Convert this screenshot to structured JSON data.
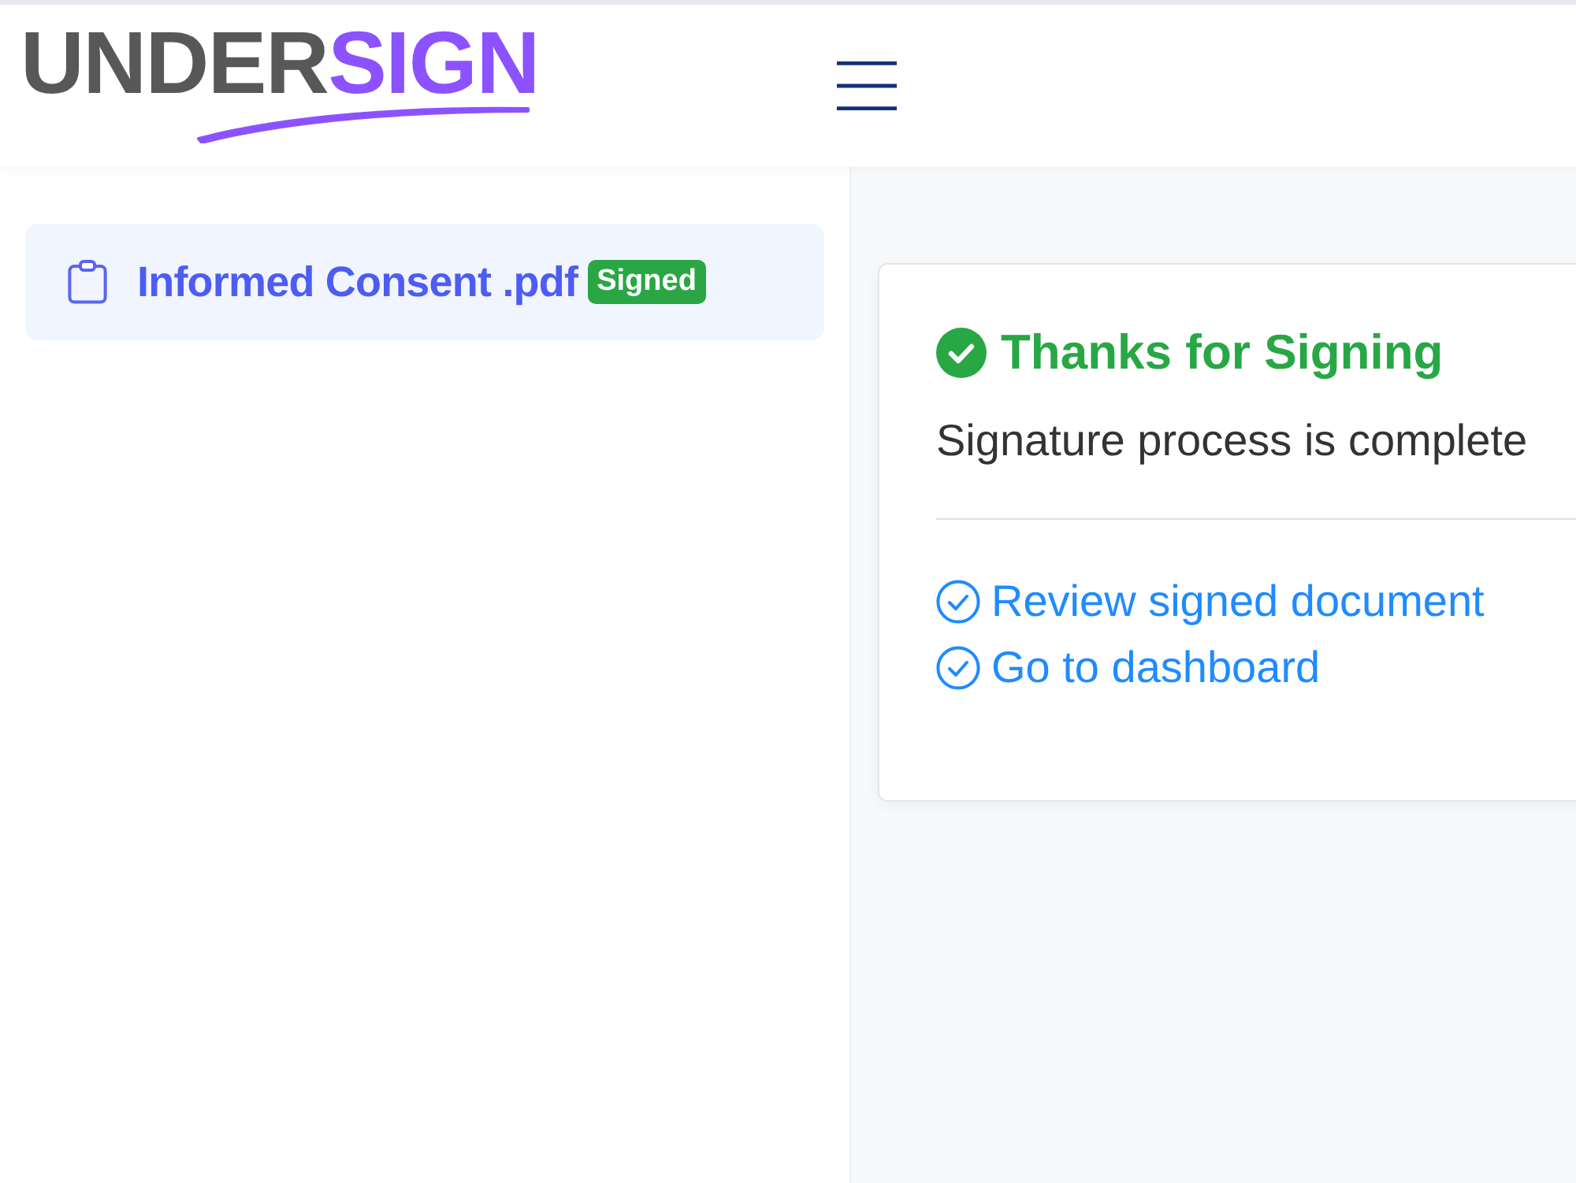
{
  "header": {
    "logo": {
      "text_main": "UNDER",
      "text_accent": "SIGN"
    }
  },
  "sidebar": {
    "items": [
      {
        "label": "Informed Consent .pdf",
        "badge": "Signed",
        "selected": true
      }
    ]
  },
  "card": {
    "title": "Thanks for Signing",
    "message": "Signature process is complete",
    "links": [
      "Review signed document",
      "Go to dashboard"
    ]
  }
}
